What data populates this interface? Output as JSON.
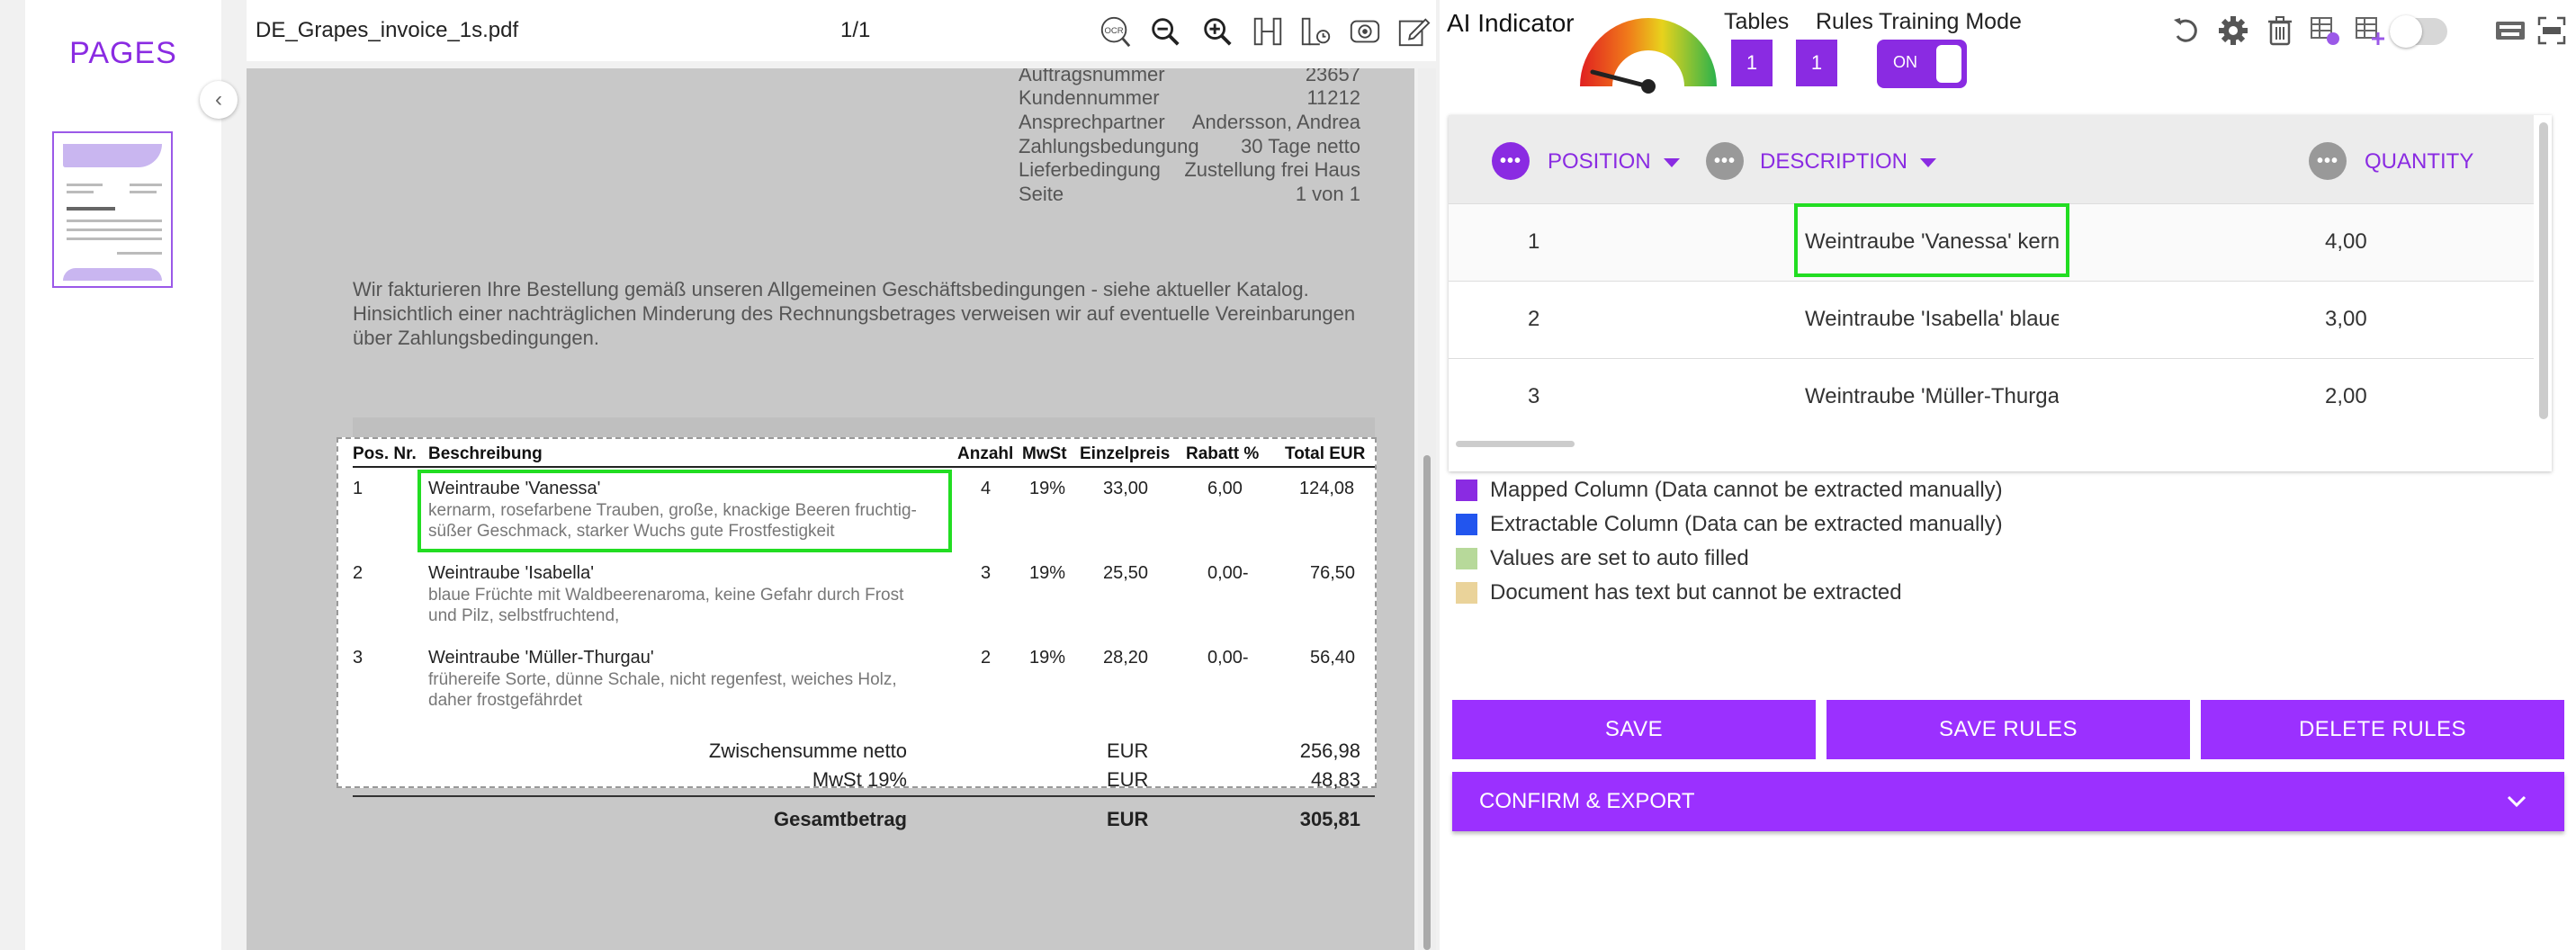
{
  "sidebar": {
    "title": "PAGES",
    "collapse_icon": "chevron-left-icon"
  },
  "viewer": {
    "file_name": "DE_Grapes_invoice_1s.pdf",
    "page_indicator": "1/1",
    "tools": [
      "ocr-search-icon",
      "zoom-out-icon",
      "zoom-in-icon",
      "column-split-icon",
      "table-settings-icon",
      "field-detect-icon",
      "edit-icon"
    ],
    "ocr_label": "OCR"
  },
  "document": {
    "meta": [
      {
        "label": "Auftragsnummer",
        "value": "23657"
      },
      {
        "label": "Kundennummer",
        "value": "11212"
      },
      {
        "label": "Ansprechpartner",
        "value": "Andersson, Andrea"
      },
      {
        "label": "Zahlungsbedungung",
        "value": "30 Tage netto"
      },
      {
        "label": "Lieferbedingung",
        "value": "Zustellung frei Haus"
      },
      {
        "label": "Seite",
        "value": "1 von 1"
      }
    ],
    "paragraph": [
      "Wir fakturieren Ihre Bestellung gemäß unseren Allgemeinen Geschäftsbedingungen - siehe aktueller Katalog.",
      "Hinsichtlich einer nachträglichen Minderung des Rechnungsbetrages verweisen wir auf eventuelle Vereinbarungen",
      "über Zahlungsbedingungen."
    ],
    "table_headers": [
      "Pos. Nr.",
      "Beschreibung",
      "Anzahl",
      "MwSt",
      "Einzelpreis",
      "Rabatt %",
      "Total EUR"
    ],
    "rows": [
      {
        "pos": "1",
        "title": "Weintraube 'Vanessa'",
        "desc": "kernarm, rosefarbene Trauben, große, knackige Beeren fruchtig-süßer Geschmack, starker Wuchs gute Frostfestigkeit",
        "qty": "4",
        "vat": "19%",
        "price": "33,00",
        "discount": "6,00",
        "total": "124,08"
      },
      {
        "pos": "2",
        "title": "Weintraube 'Isabella'",
        "desc": "blaue Früchte mit Waldbeerenaroma, keine Gefahr durch Frost und Pilz, selbstfruchtend,",
        "qty": "3",
        "vat": "19%",
        "price": "25,50",
        "discount": "0,00-",
        "total": "76,50"
      },
      {
        "pos": "3",
        "title": "Weintraube 'Müller-Thurgau'",
        "desc": "frühereife Sorte, dünne Schale, nicht regenfest, weiches Holz, daher frostgefährdet",
        "qty": "2",
        "vat": "19%",
        "price": "28,20",
        "discount": "0,00-",
        "total": "56,40"
      }
    ],
    "totals": [
      {
        "label": "Zwischensumme netto",
        "currency": "EUR",
        "value": "256,98"
      },
      {
        "label": "MwSt 19%",
        "currency": "EUR",
        "value": "48,83"
      },
      {
        "label": "Gesamtbetrag",
        "currency": "EUR",
        "value": "305,81"
      }
    ]
  },
  "panel": {
    "ai_indicator": "AI Indicator",
    "tables_label": "Tables",
    "rules_label": "Rules",
    "training_label": "Training Mode",
    "tables_count": "1",
    "rules_count": "1",
    "training_state": "ON",
    "toolbar_icons": [
      "undo-icon",
      "gear-icon",
      "trash-icon",
      "table-edit-icon",
      "table-add-icon",
      "toggle-switch",
      "keyboard-icon",
      "ocr-icon"
    ],
    "colors": {
      "accent": "#8a2be2",
      "button": "#9b30ff",
      "highlight": "#22dd22"
    }
  },
  "grid": {
    "columns": [
      "POSITION",
      "DESCRIPTION",
      "QUANTITY"
    ],
    "rows": [
      {
        "position": "1",
        "description": "Weintraube 'Vanessa' kernarm, rosefarbene Trau",
        "quantity": "4,00"
      },
      {
        "position": "2",
        "description": "Weintraube 'Isabella' blaue Früchte mit Waldbee",
        "quantity": "3,00"
      },
      {
        "position": "3",
        "description": "Weintraube 'Müller-Thurgau' frühereife Sorte, dü",
        "quantity": "2,00"
      }
    ]
  },
  "legend": [
    {
      "label": "Mapped Column (Data cannot be extracted manually)",
      "color": "#8a2be2"
    },
    {
      "label": "Extractable Column (Data can be extracted manually)",
      "color": "#2255ee"
    },
    {
      "label": "Values are set to auto filled",
      "color": "#b7d99a"
    },
    {
      "label": "Document has text but cannot be extracted",
      "color": "#ead39a"
    }
  ],
  "buttons": {
    "save": "SAVE",
    "save_rules": "SAVE RULES",
    "delete_rules": "DELETE RULES",
    "confirm_export": "CONFIRM & EXPORT"
  }
}
